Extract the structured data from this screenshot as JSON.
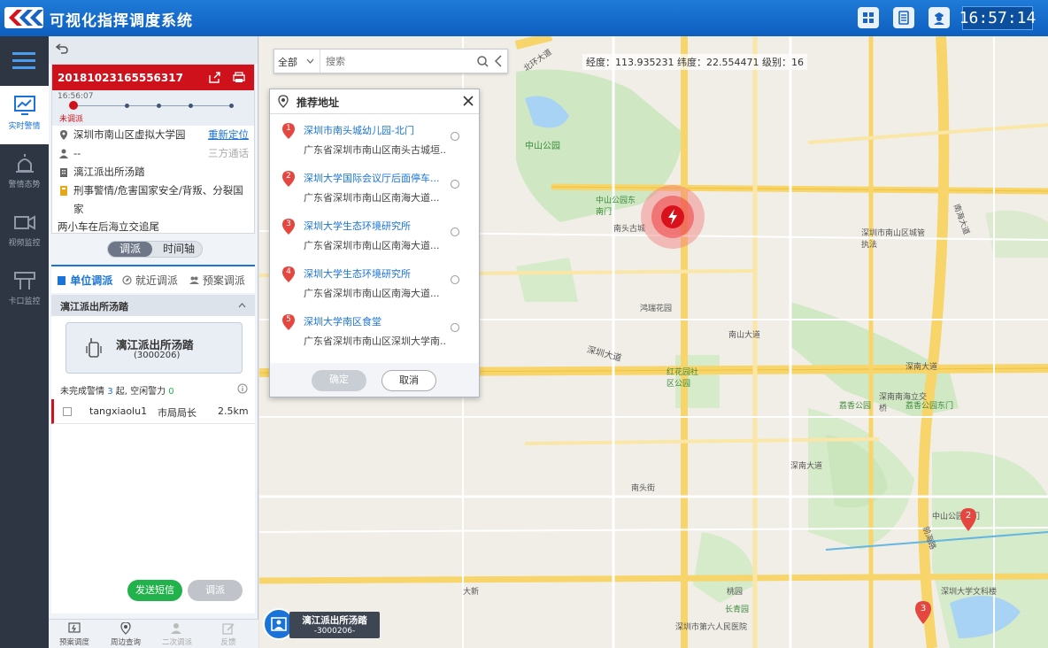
{
  "header": {
    "title": "可视化指挥调度系统",
    "time": "16:57:14",
    "icons": [
      "grid-icon",
      "document-icon",
      "police-officer-icon"
    ]
  },
  "sidebar": {
    "items": [
      {
        "label": "实时警情",
        "icon": "chart-monitor-icon",
        "active": true
      },
      {
        "label": "警情态势",
        "icon": "alarm-siren-icon",
        "active": false
      },
      {
        "label": "视频监控",
        "icon": "video-camera-icon",
        "active": false
      },
      {
        "label": "卡口监控",
        "icon": "checkpoint-icon",
        "active": false
      }
    ]
  },
  "case": {
    "id": "20181023165556317",
    "time": "16:56:07",
    "status": "未调派",
    "address": "深圳市南山区虚拟大学园",
    "relocate": "重新定位",
    "caller": "--",
    "three_way": "三方通话",
    "station": "漓江派出所汤踏",
    "type_line1": "刑事警情/危害国家安全/背叛、分裂国家",
    "type_line2": "两小车在后海立交追尾"
  },
  "toggle": {
    "dispatch": "调派",
    "timeline": "时间轴"
  },
  "tabs": {
    "unit": "单位调派",
    "nearby": "就近调派",
    "plan": "预案调派"
  },
  "unit": {
    "group": "漓江派出所汤踏",
    "card_name": "漓江派出所汤踏",
    "card_code": "(3000206)",
    "stats_prefix": "未完成警情",
    "stats_count": "3",
    "stats_mid": "起, 空闲警力",
    "stats_free": "0",
    "rows": [
      {
        "name": "tangxiaolu1",
        "role": "市局局长",
        "distance": "2.5km"
      }
    ],
    "send_sms": "发送短信",
    "dispatch": "调派"
  },
  "bottom": [
    {
      "label": "预案调度",
      "icon": "plan-icon"
    },
    {
      "label": "周边查询",
      "icon": "location-pin-icon"
    },
    {
      "label": "二次调派",
      "icon": "user-add-icon"
    },
    {
      "label": "反馈",
      "icon": "edit-icon"
    }
  ],
  "map": {
    "search_scope": "全部",
    "search_placeholder": "搜索",
    "coords": "经度：113.935231  纬度：22.554471  级别：16",
    "station_tag": {
      "name": "漓江派出所汤踏",
      "code": "-3000206-"
    },
    "labels": [
      "北环大道",
      "中山公园",
      "中山公园东南门",
      "南头古城",
      "深圳大道",
      "红花园社区公园",
      "深南大道",
      "荔香公园",
      "深南大道",
      "南头街",
      "长青园",
      "桃园",
      "大新",
      "前海路",
      "南海大道",
      "南山大道",
      "深南南海立交桥",
      "深圳市第六人民医院",
      "鸿瑞花园",
      "深圳市南山区城管执法",
      "中山公园南门",
      "深圳大学文科楼",
      "荔香公园东门"
    ],
    "markers": [
      "2",
      "3"
    ]
  },
  "recommend": {
    "title": "推荐地址",
    "items": [
      {
        "n": "1",
        "name": "深圳市南头城幼儿园-北门",
        "addr": "广东省深圳市南山区南头古城垣..."
      },
      {
        "n": "2",
        "name": "深圳大学国际会议厅后面停车...",
        "addr": "广东省深圳市南山区南海大道..."
      },
      {
        "n": "3",
        "name": "深圳大学生态环境研究所",
        "addr": "广东省深圳市南山区南海大道..."
      },
      {
        "n": "4",
        "name": "深圳大学生态环境研究所",
        "addr": "广东省深圳市南山区南海大道..."
      },
      {
        "n": "5",
        "name": "深圳大学南区食堂",
        "addr": "广东省深圳市南山区深圳大学南..."
      }
    ],
    "confirm": "确定",
    "cancel": "取消"
  }
}
